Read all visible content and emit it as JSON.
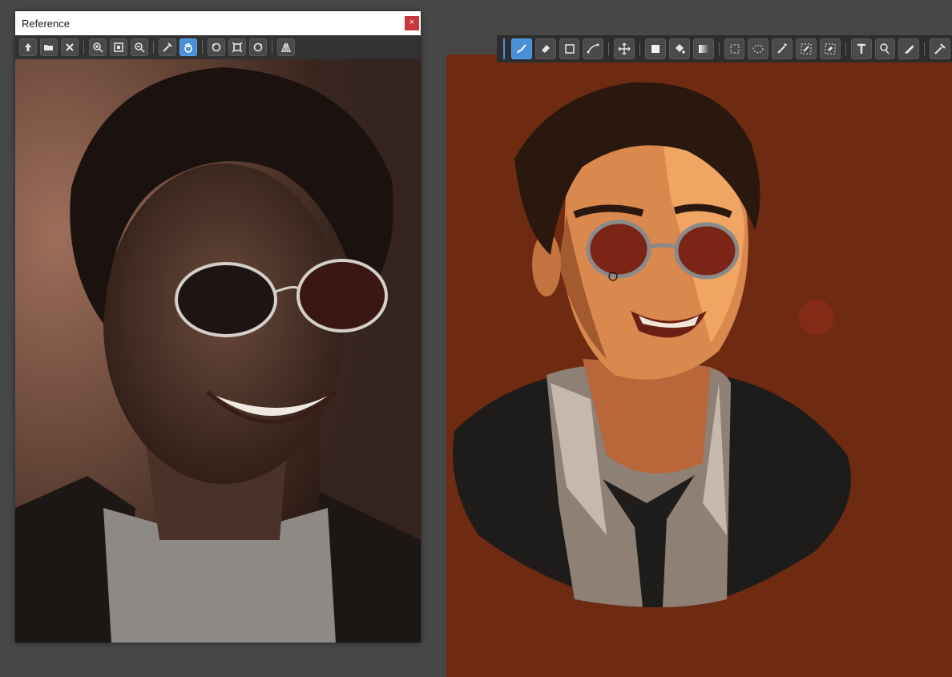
{
  "reference_window": {
    "title": "Reference",
    "close_glyph": "×",
    "toolbar": [
      "load-image-icon",
      "open-folder-icon",
      "clear-icon",
      "zoom-in-icon",
      "fit-to-window-icon",
      "zoom-out-icon",
      "eyedropper-icon",
      "hand-pan-icon",
      "rotate-left-icon",
      "reset-view-icon",
      "rotate-right-icon",
      "flip-icon"
    ],
    "active_tool": "hand-pan-icon"
  },
  "main_toolbar": {
    "tools": [
      "brush-icon",
      "eraser-icon",
      "rectangle-icon",
      "pen-curve-icon",
      "move-icon",
      "fill-color-icon",
      "paint-bucket-icon",
      "gradient-icon",
      "rect-select-icon",
      "lasso-select-icon",
      "magic-wand-icon",
      "select-pen-icon",
      "select-eraser-icon",
      "text-icon",
      "smudge-icon",
      "blur-icon",
      "eyedropper-icon"
    ],
    "active_tool": "brush-icon"
  },
  "colors": {
    "canvas_bg": "#6e2b12",
    "workspace_bg": "#474747",
    "accent": "#4a90d9",
    "close_button": "#c8373b"
  }
}
